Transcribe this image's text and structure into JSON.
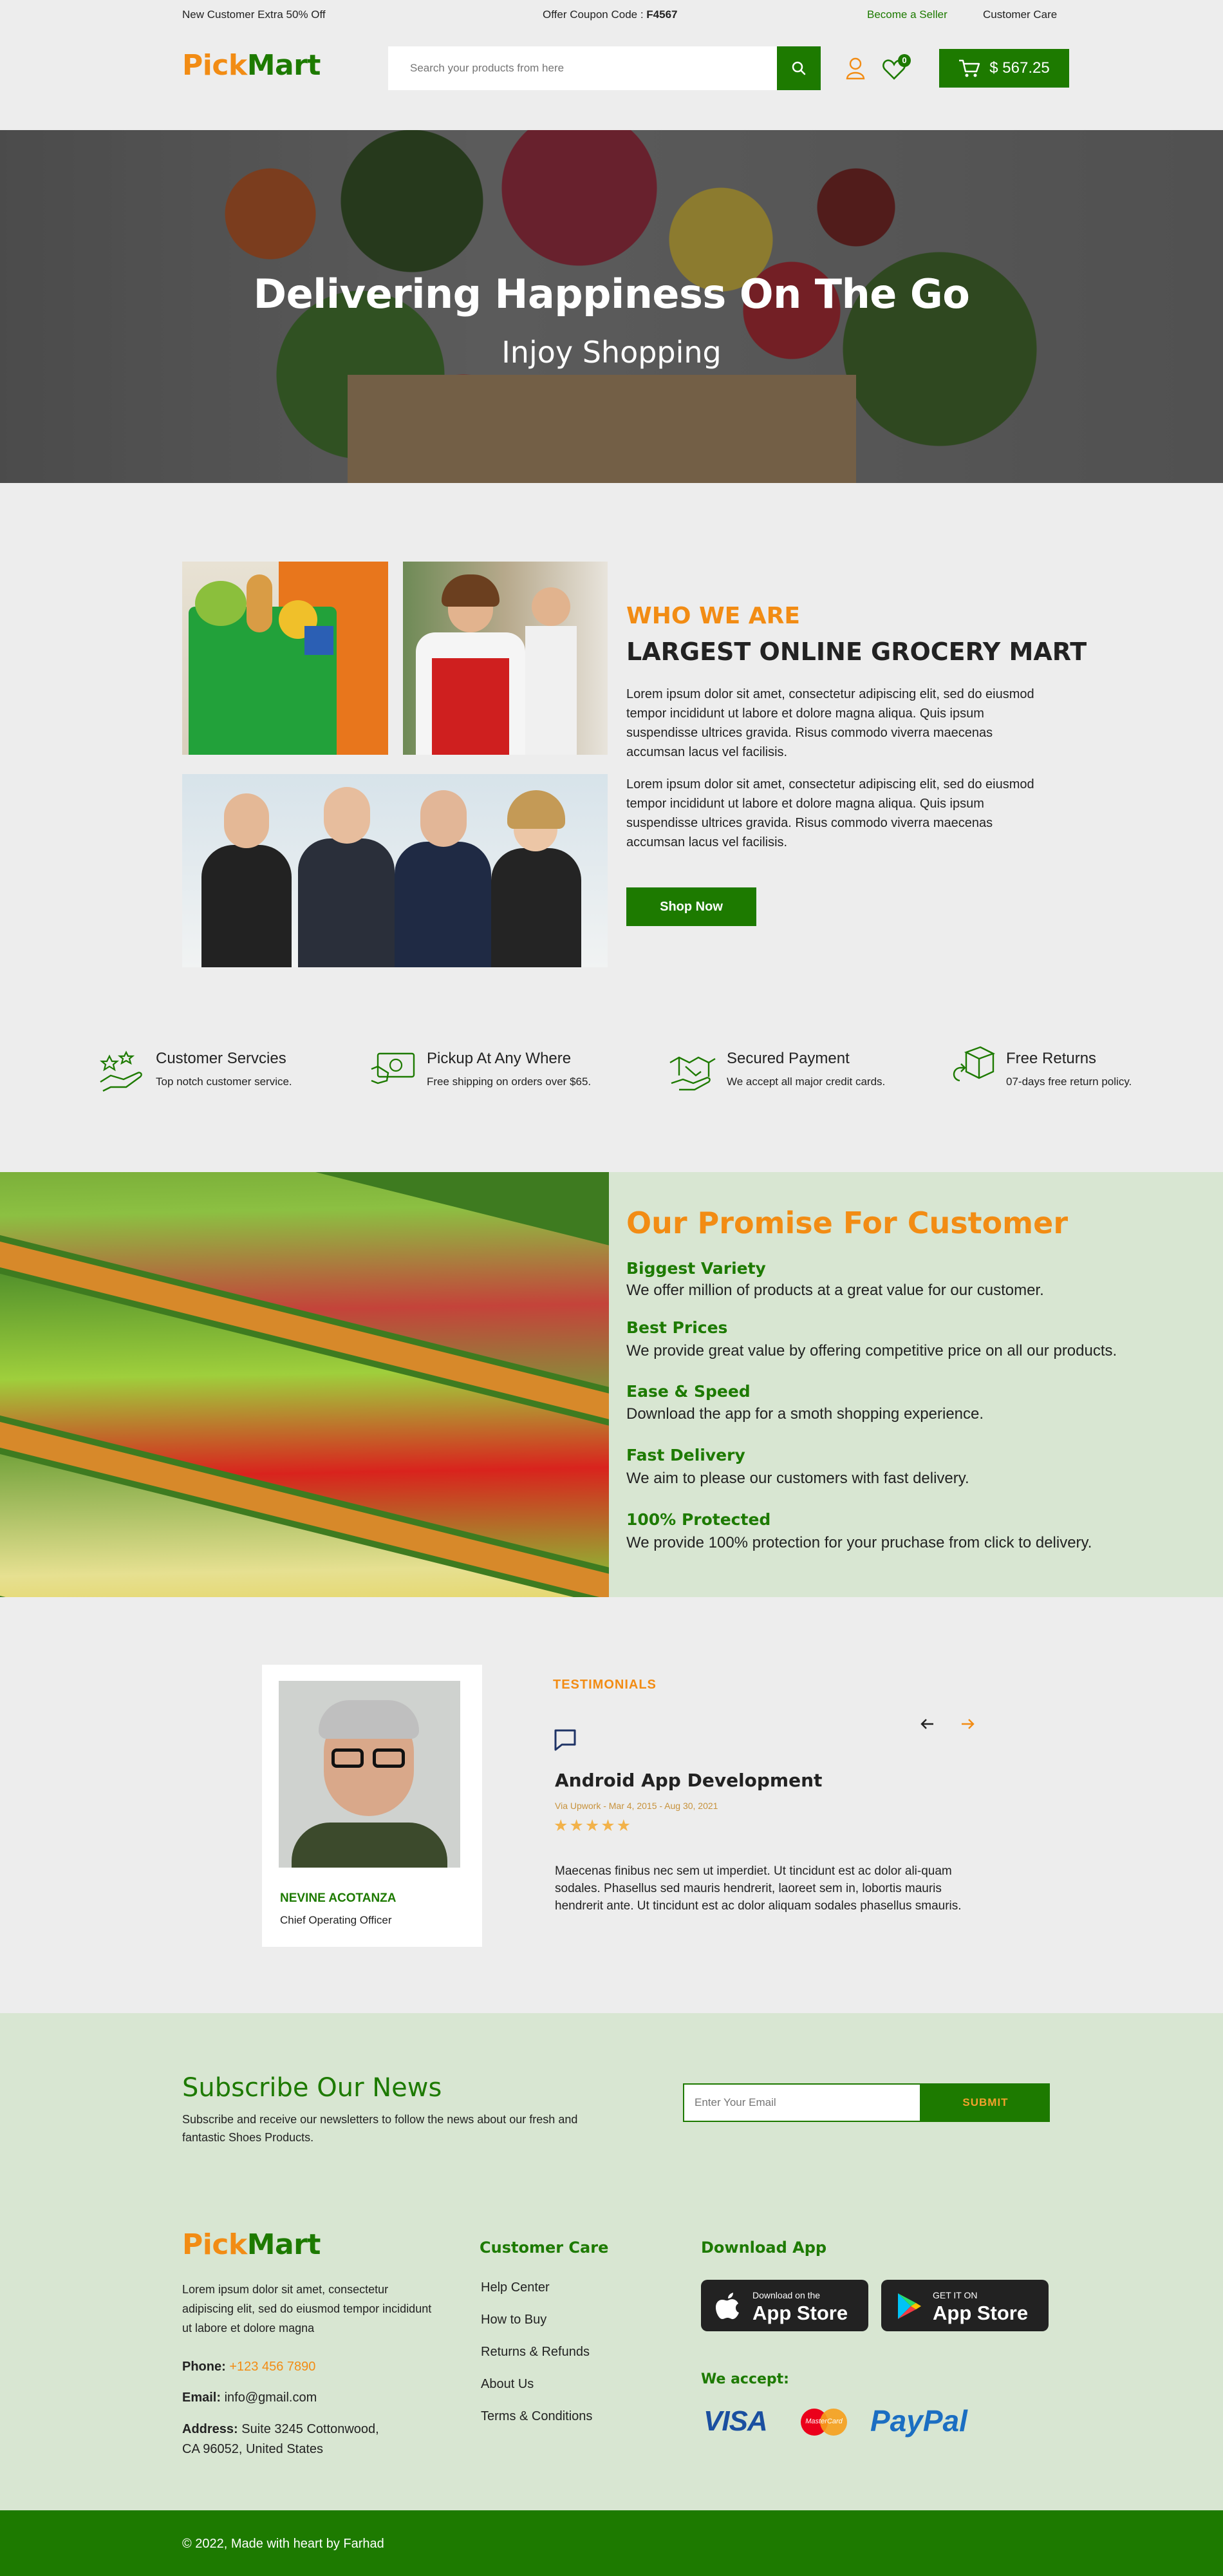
{
  "topbar": {
    "promo": "New Customer Extra 50% Off",
    "coupon_label": "Offer Coupon Code : ",
    "coupon_code": "F4567",
    "seller_link": "Become a Seller",
    "care_link": "Customer Care"
  },
  "header": {
    "logo_a": "Pick",
    "logo_b": "Mart",
    "search_placeholder": "Search your products from here",
    "wishlist_count": "0",
    "cart_total": "$ 567.25"
  },
  "hero": {
    "title": "Delivering Happiness On The Go",
    "subtitle": "Injoy Shopping"
  },
  "about": {
    "kicker": "WHO WE ARE",
    "title": "LARGEST ONLINE GROCERY MART",
    "para1": "Lorem ipsum dolor sit amet, consectetur adipiscing elit, sed do eiusmod tempor incididunt ut labore et dolore magna aliqua. Quis ipsum suspendisse ultrices gravida. Risus commodo viverra maecenas accumsan lacus vel facilisis.",
    "para2": "Lorem ipsum dolor sit amet, consectetur adipiscing elit, sed do eiusmod tempor incididunt ut labore et dolore magna aliqua. Quis ipsum suspendisse ultrices gravida. Risus commodo viverra maecenas accumsan lacus vel facilisis.",
    "button": "Shop Now"
  },
  "features": [
    {
      "title": "Customer Servcies",
      "text": "Top notch customer service.",
      "icon": "hand-stars-icon"
    },
    {
      "title": "Pickup At Any Where",
      "text": "Free shipping on orders over $65.",
      "icon": "cash-icon"
    },
    {
      "title": "Secured Payment",
      "text": "We accept all major credit cards.",
      "icon": "handshake-icon"
    },
    {
      "title": "Free Returns",
      "text": "07-days free return policy.",
      "icon": "return-box-icon"
    }
  ],
  "promise": {
    "title": "Our Promise For Customer",
    "items": [
      {
        "heading": "Biggest Variety",
        "text": "We offer million of products at a great value for our customer."
      },
      {
        "heading": "Best Prices",
        "text": "We provide great value by offering competitive price on all our products."
      },
      {
        "heading": "Ease & Speed",
        "text": "Download the app for a smoth shopping experience."
      },
      {
        "heading": "Fast Delivery",
        "text": "We aim to please our customers with fast delivery."
      },
      {
        "heading": "100% Protected",
        "text": "We provide 100% protection for your pruchase from click to delivery."
      }
    ]
  },
  "testimonial": {
    "label": "TESTIMONIALS",
    "name": "NEVINE ACOTANZA",
    "role": "Chief Operating Officer",
    "title": "Android App Development",
    "meta": "Via Upwork - Mar 4, 2015 - Aug 30, 2021",
    "stars": "★★★★★",
    "rating": 5,
    "body": "Maecenas finibus nec sem ut imperdiet. Ut tincidunt est ac dolor ali-quam sodales. Phasellus sed mauris hendrerit, laoreet sem in, lobortis mauris hendrerit ante. Ut tincidunt est ac dolor aliquam sodales phasellus smauris."
  },
  "subscribe": {
    "title": "Subscribe Our News",
    "text": "Subscribe and receive our newsletters to follow the news about our fresh and fantastic Shoes Products.",
    "placeholder": "Enter Your Email",
    "button": "SUBMIT"
  },
  "footer": {
    "about": "Lorem ipsum dolor sit amet, consectetur adipiscing elit, sed do eiusmod tempor incididunt ut labore et dolore magna",
    "phone_label": "Phone: ",
    "phone": "+123 456 7890",
    "email_label": "Email: ",
    "email": "info@gmail.com",
    "address_label": "Address: ",
    "address1": "Suite 3245 Cottonwood,",
    "address2": "CA 96052, United States",
    "care_heading": "Customer Care",
    "care_links": [
      "Help Center",
      "How to Buy",
      "Returns & Refunds",
      "About Us",
      "Terms & Conditions"
    ],
    "app_heading": "Download App",
    "apple_small": "Download on the",
    "apple_big": "App Store",
    "google_small": "GET IT ON",
    "google_big": "App Store",
    "accept_heading": "We accept:",
    "payment": [
      "VISA",
      "MasterCard",
      "PayPal"
    ],
    "copyright": "© 2022, Made with heart by Farhad"
  },
  "colors": {
    "primary_green": "#1d7a00",
    "accent_orange": "#f28c14",
    "panel_green": "#d8e6d2"
  }
}
